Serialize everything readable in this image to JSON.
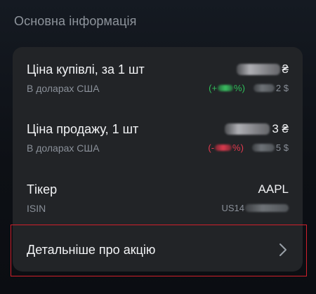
{
  "section": {
    "title": "Основна інформація"
  },
  "rows": [
    {
      "title": "Ціна купівлі, за 1 шт",
      "subtitle": "В доларах США",
      "value_suffix": "₴",
      "change_open": "(+",
      "change_close": "%)",
      "usd_suffix": "2 $"
    },
    {
      "title": "Ціна продажу, 1 шт",
      "subtitle": "В доларах США",
      "value_suffix": "3 ₴",
      "change_open": "(-",
      "change_close": "%)",
      "usd_suffix": "5 $"
    },
    {
      "title": "Тікер",
      "subtitle": "ISIN",
      "value": "AAPL",
      "isin_prefix": "US14"
    }
  ],
  "details_link": {
    "label": "Детальніше про акцію",
    "icon": "chevron-right-icon"
  },
  "colors": {
    "positive": "#2fbf5a",
    "negative": "#e63a4f",
    "highlight_border": "#d0202b"
  }
}
